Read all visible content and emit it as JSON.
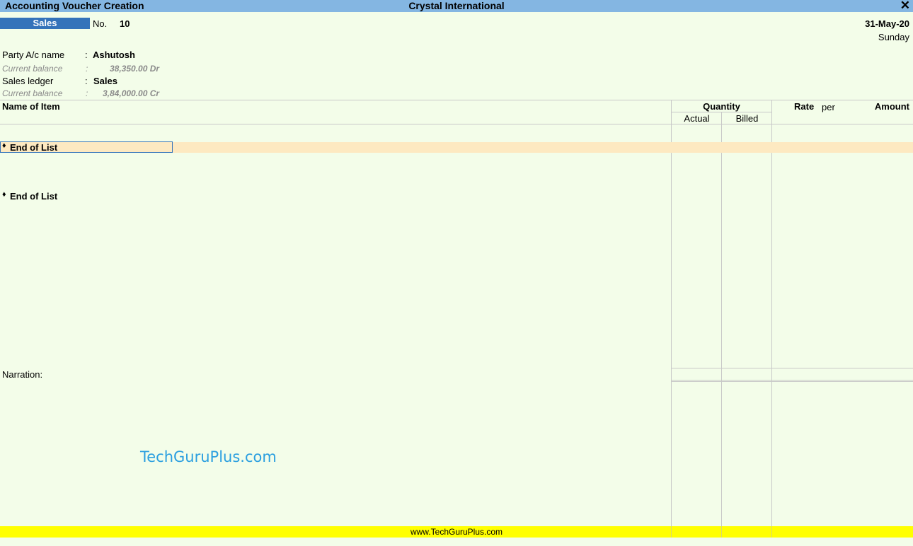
{
  "window": {
    "title": "Accounting Voucher Creation",
    "company": "Crystal International",
    "close_glyph": "✕"
  },
  "voucher": {
    "type": "Sales",
    "no_label": "No.",
    "no": "10",
    "date": "31-May-20",
    "day": "Sunday"
  },
  "party": {
    "label": "Party A/c name",
    "sep": ":",
    "value": "Ashutosh",
    "balance_label": "Current balance",
    "balance_sep": ":",
    "balance": "38,350.00 Dr"
  },
  "sales_ledger": {
    "label": "Sales ledger",
    "sep": ":",
    "value": "Sales",
    "balance_label": "Current balance",
    "balance_sep": ":",
    "balance": "3,84,000.00 Cr"
  },
  "table": {
    "name_header": "Name of Item",
    "quantity_header": "Quantity",
    "actual_header": "Actual",
    "billed_header": "Billed",
    "rate_header": "Rate",
    "per_header": "per",
    "amount_header": "Amount"
  },
  "list": {
    "bullet": "♦",
    "selected_item": "End of List",
    "item": "End of List"
  },
  "narration_label": "Narration:",
  "watermark": "TechGuruPlus.com",
  "footer_text": "www.TechGuruPlus.com",
  "colors": {
    "background": "#f3fde9",
    "titlebar": "#84b6e2",
    "voucher_type_bg": "#3473ba",
    "highlight_row": "#fde9c1",
    "footer": "#ffff00",
    "watermark": "#2b9fe0"
  }
}
